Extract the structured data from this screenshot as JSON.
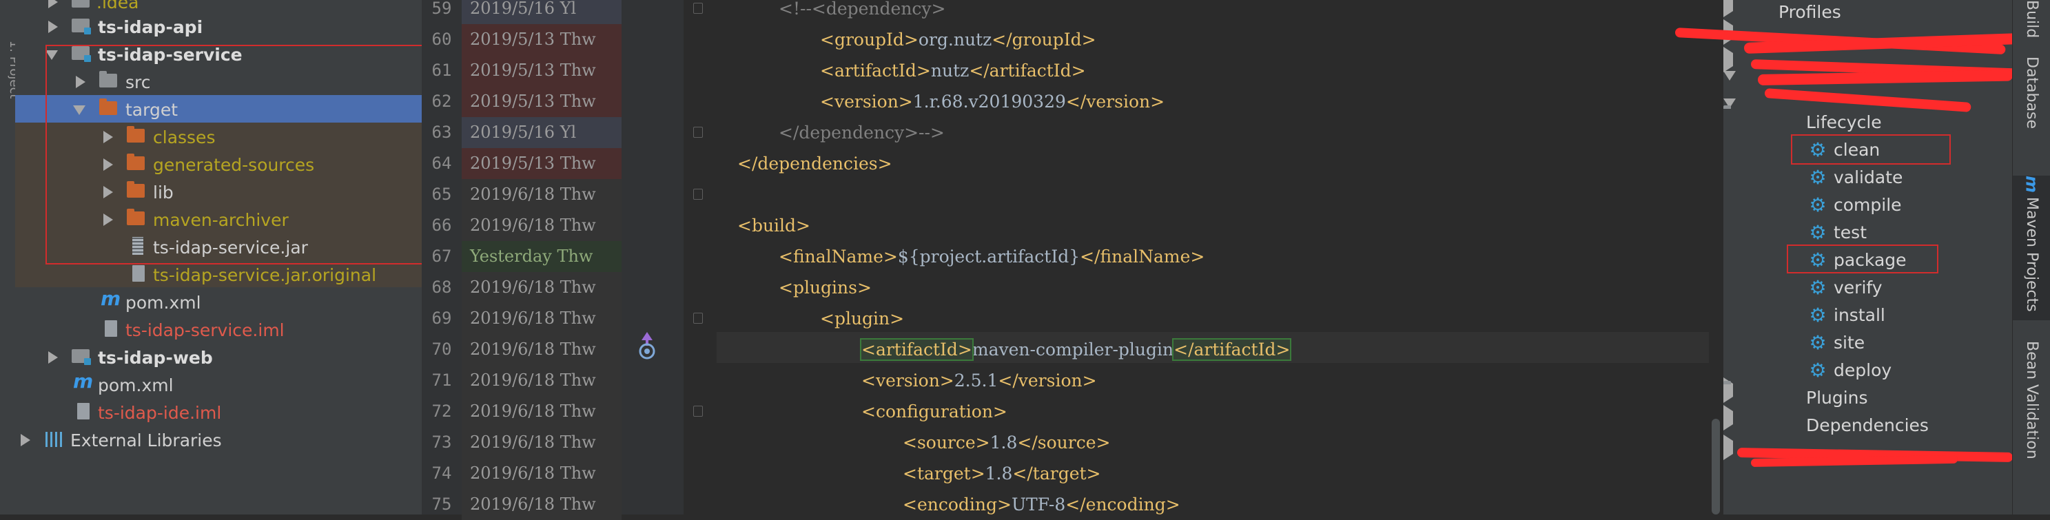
{
  "left_strip": {
    "label": "1: Project"
  },
  "project_tree": [
    {
      "label": ".idea",
      "indent": 1,
      "expanded": false
    },
    {
      "label": "ts-idap-api",
      "indent": 1,
      "expanded": false
    },
    {
      "label": "ts-idap-service",
      "indent": 1,
      "expanded": true
    },
    {
      "label": "src",
      "indent": 2,
      "expanded": false
    },
    {
      "label": "target",
      "indent": 2,
      "expanded": true,
      "selected": true
    },
    {
      "label": "classes",
      "indent": 3,
      "expanded": false
    },
    {
      "label": "generated-sources",
      "indent": 3,
      "expanded": false
    },
    {
      "label": "lib",
      "indent": 3,
      "expanded": false
    },
    {
      "label": "maven-archiver",
      "indent": 3,
      "expanded": false
    },
    {
      "label": "ts-idap-service.jar",
      "indent": 3
    },
    {
      "label": "ts-idap-service.jar.original",
      "indent": 3
    },
    {
      "label": "pom.xml",
      "indent": 2
    },
    {
      "label": "ts-idap-service.iml",
      "indent": 2
    },
    {
      "label": "ts-idap-web",
      "indent": 1,
      "expanded": false
    },
    {
      "label": "pom.xml",
      "indent": 1
    },
    {
      "label": "ts-idap-ide.iml",
      "indent": 1
    },
    {
      "label": "External Libraries",
      "indent": 0,
      "expanded": false
    }
  ],
  "editor": {
    "line_numbers": [
      "59",
      "60",
      "61",
      "62",
      "63",
      "64",
      "65",
      "66",
      "67",
      "68",
      "69",
      "70",
      "71",
      "72",
      "73",
      "74",
      "75"
    ],
    "annotations": [
      "2019/5/16 Yl",
      "2019/5/13 Thw",
      "2019/5/13 Thw",
      "2019/5/13 Thw",
      "2019/5/16 Yl",
      "2019/5/13 Thw",
      "2019/6/18 Thw",
      "2019/6/18 Thw",
      "Yesterday Thw",
      "2019/6/18 Thw",
      "2019/6/18 Thw",
      "2019/6/18 Thw",
      "2019/6/18 Thw",
      "2019/6/18 Thw",
      "2019/6/18 Thw",
      "2019/6/18 Thw",
      "2019/6/18 Thw"
    ],
    "code": {
      "l59": "<!--<dependency>",
      "l60_open": "<groupId>",
      "l60_val": "org.nutz",
      "l60_close": "</groupId>",
      "l61_open": "<artifactId>",
      "l61_val": "nutz",
      "l61_close": "</artifactId>",
      "l62_open": "<version>",
      "l62_val": "1.r.68.v20190329",
      "l62_close": "</version>",
      "l63": "</dependency>-->",
      "l64": "</dependencies>",
      "l66": "<build>",
      "l67_open": "<finalName>",
      "l67_val": "${project.artifactId}",
      "l67_close": "</finalName>",
      "l68": "<plugins>",
      "l69": "<plugin>",
      "l70_open": "<artifactId>",
      "l70_val": "maven-compiler-plugin",
      "l70_close": "</artifactId>",
      "l71_open": "<version>",
      "l71_val": "2.5.1",
      "l71_close": "</version>",
      "l72": "<configuration>",
      "l73_open": "<source>",
      "l73_val": "1.8",
      "l73_close": "</source>",
      "l74_open": "<target>",
      "l74_val": "1.8",
      "l74_close": "</target>",
      "l75_open": "<encoding>",
      "l75_val": "UTF-8",
      "l75_close": "</encoding>"
    }
  },
  "maven": {
    "profiles": "Profiles",
    "lifecycle": "Lifecycle",
    "goals": [
      "clean",
      "validate",
      "compile",
      "test",
      "package",
      "verify",
      "install",
      "site",
      "deploy"
    ],
    "plugins": "Plugins",
    "dependencies": "Dependencies"
  },
  "right_strip": {
    "build": "Build",
    "database": "Database",
    "maven_projects": "Maven Projects",
    "bean_validation": "Bean Validation"
  },
  "colors": {
    "selection": "#4b6eaf",
    "highlight_box": "#d22c2c",
    "scribble": "#ff2b2b",
    "xml_tag": "#e8bf6a",
    "gear": "#3aa0d8"
  }
}
